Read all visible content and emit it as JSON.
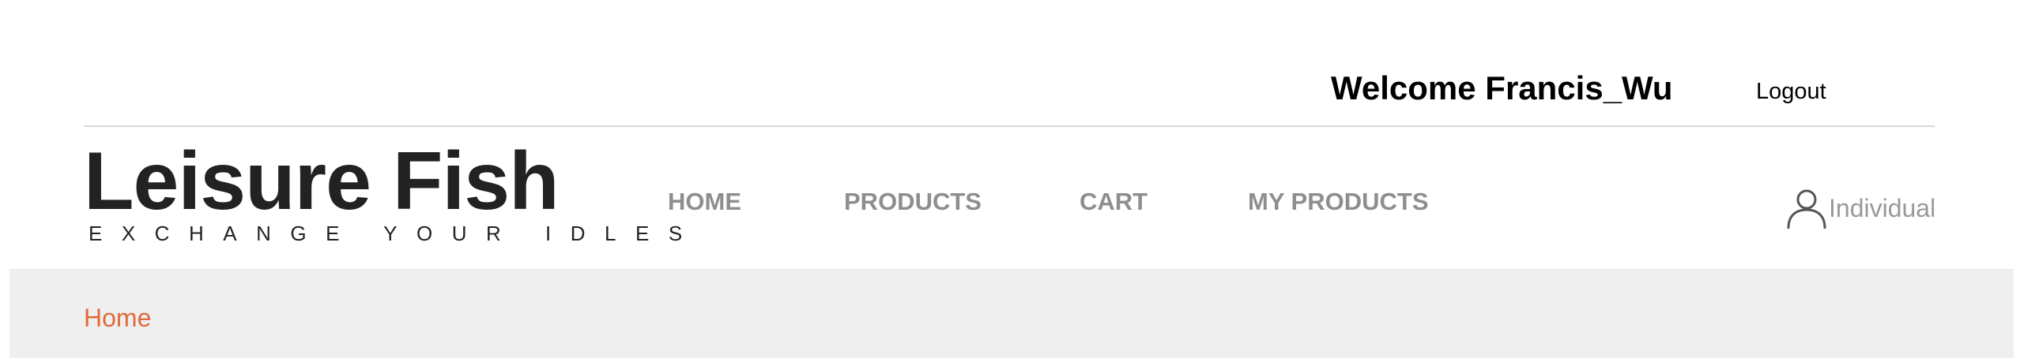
{
  "header": {
    "welcome_text": "Welcome Francis_Wu",
    "logout_label": "Logout"
  },
  "brand": {
    "title": "Leisure Fish",
    "tagline": "EXCHANGE YOUR IDLES"
  },
  "nav": {
    "items": [
      {
        "label": "HOME"
      },
      {
        "label": "PRODUCTS"
      },
      {
        "label": "CART"
      },
      {
        "label": "MY PRODUCTS"
      }
    ]
  },
  "user_menu": {
    "icon": "user-icon",
    "label": "Individual"
  },
  "breadcrumb": {
    "items": [
      {
        "label": "Home"
      }
    ]
  },
  "colors": {
    "brand_text": "#222222",
    "nav_text": "#8e8e8e",
    "breadcrumb_accent": "#e06a3b",
    "breadcrumb_background": "#efefef"
  }
}
